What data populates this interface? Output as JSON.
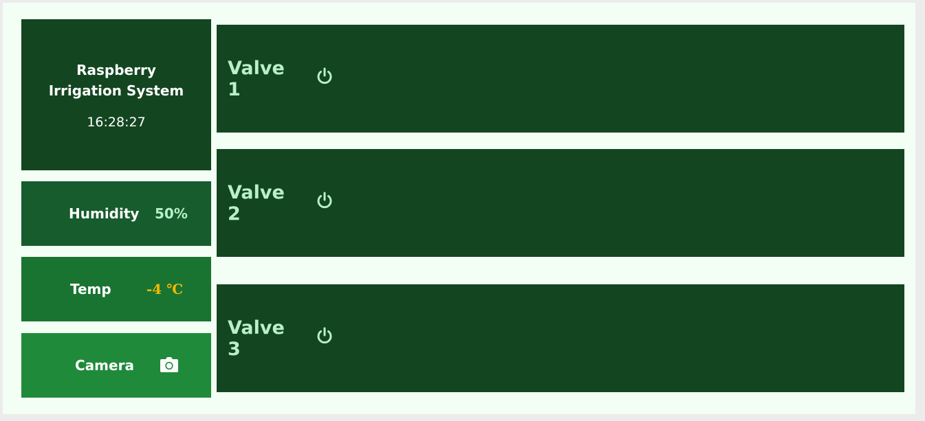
{
  "header": {
    "app_title": "Raspberry Irrigation System",
    "time": "16:28:27"
  },
  "sensors": {
    "humidity": {
      "label": "Humidity",
      "value": "50%"
    },
    "temp": {
      "label": "Temp",
      "value": "-4 ℃"
    },
    "camera": {
      "label": "Camera",
      "icon": "camera-icon"
    }
  },
  "valves": [
    {
      "label": "Valve 1",
      "icon": "power-icon"
    },
    {
      "label": "Valve 2",
      "icon": "power-icon"
    },
    {
      "label": "Valve 3",
      "icon": "power-icon"
    }
  ],
  "colors": {
    "background": "#f3fff4",
    "dark_tile": "#134620",
    "accent_text": "#b9f0c8",
    "temp_value": "#f5b800"
  }
}
